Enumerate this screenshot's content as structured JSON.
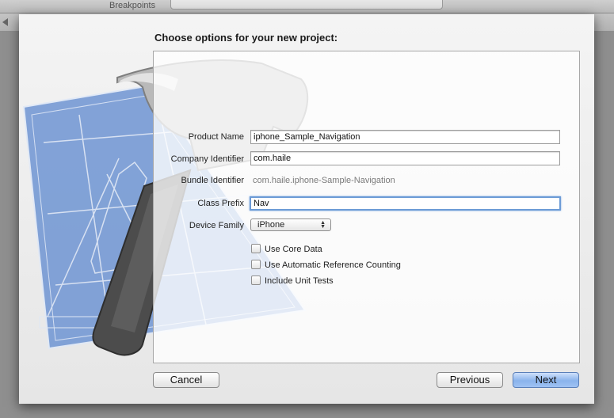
{
  "toolbar": {
    "breakpoints_label": "Breakpoints"
  },
  "sheet": {
    "title": "Choose options for your new project:"
  },
  "form": {
    "product_name": {
      "label": "Product Name",
      "value": "iphone_Sample_Navigation"
    },
    "company_identifier": {
      "label": "Company Identifier",
      "value": "com.haile"
    },
    "bundle_identifier": {
      "label": "Bundle Identifier",
      "value": "com.haile.iphone-Sample-Navigation"
    },
    "class_prefix": {
      "label": "Class Prefix",
      "value": "Nav"
    },
    "device_family": {
      "label": "Device Family",
      "selected": "iPhone"
    },
    "options": [
      {
        "label": "Use Core Data",
        "checked": false
      },
      {
        "label": "Use Automatic Reference Counting",
        "checked": false
      },
      {
        "label": "Include Unit Tests",
        "checked": false
      }
    ]
  },
  "buttons": {
    "cancel": "Cancel",
    "previous": "Previous",
    "next": "Next"
  },
  "colors": {
    "accent": "#8ab3ec",
    "focus_ring": "#6c9bd6",
    "blueprint": "#6f95d3"
  }
}
